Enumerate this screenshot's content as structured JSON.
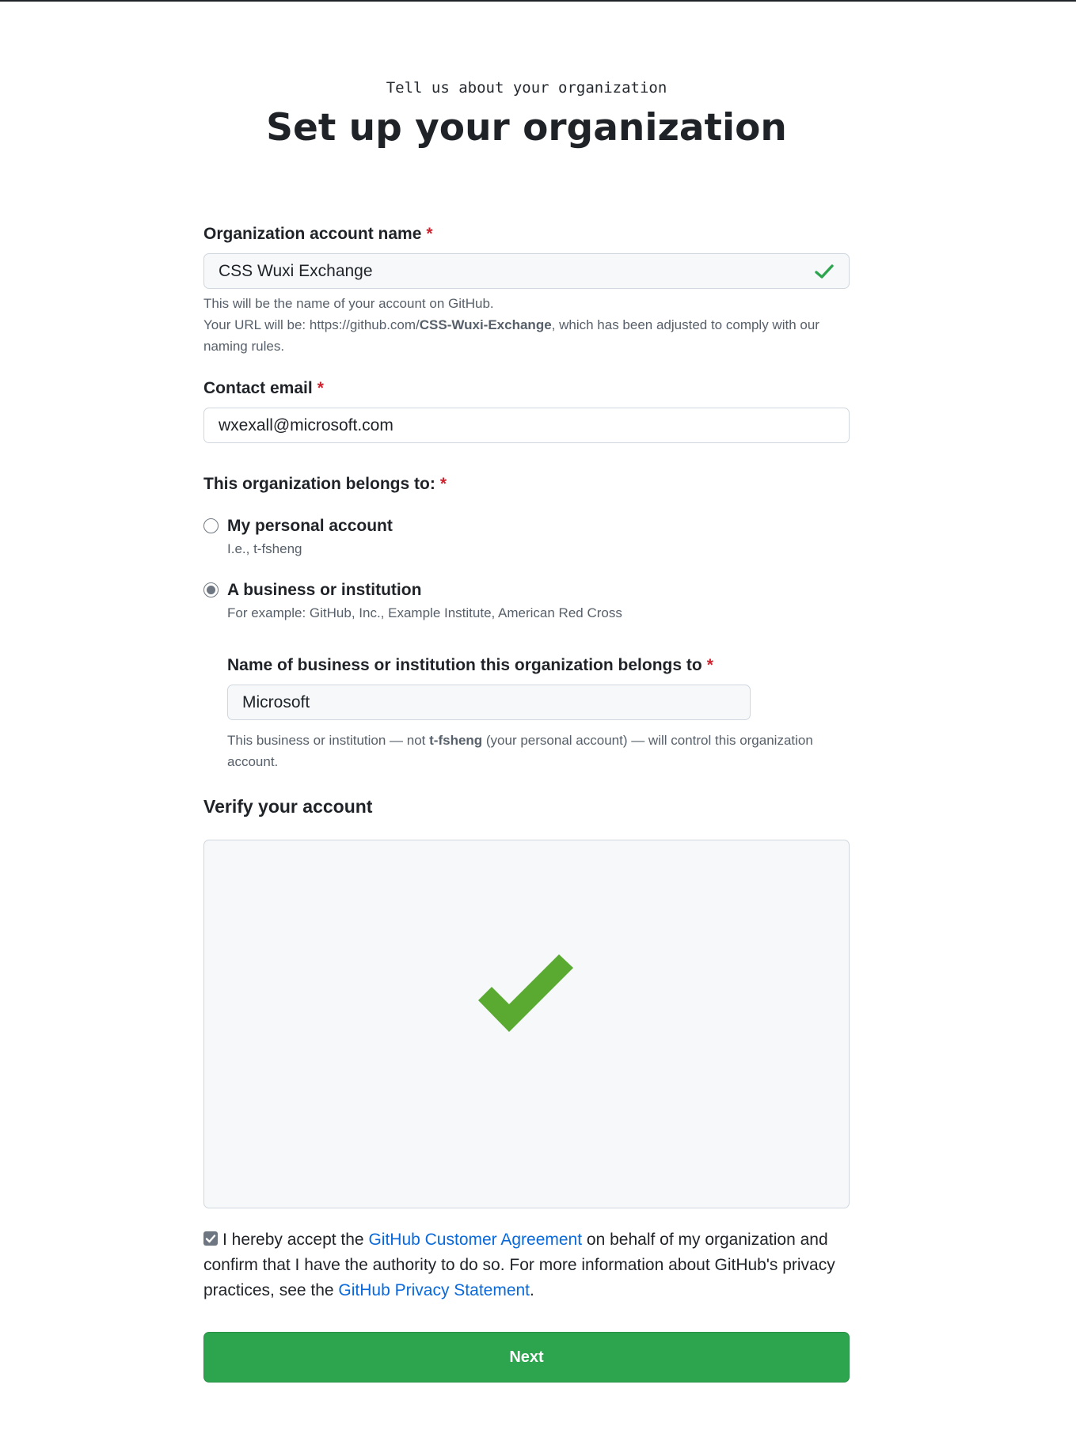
{
  "header": {
    "eyebrow": "Tell us about your organization",
    "title": "Set up your organization"
  },
  "org_name": {
    "label": "Organization account name",
    "required_mark": "*",
    "value": "CSS Wuxi Exchange",
    "status_icon": "check-icon",
    "note_line1": "This will be the name of your account on GitHub.",
    "note_prefix": "Your URL will be: https://github.com/",
    "note_slug": "CSS-Wuxi-Exchange",
    "note_suffix": ", which has been adjusted to comply with our naming rules."
  },
  "contact_email": {
    "label": "Contact email",
    "required_mark": "*",
    "value": "wxexall@microsoft.com"
  },
  "belongs_to": {
    "label": "This organization belongs to:",
    "required_mark": "*",
    "options": [
      {
        "label": "My personal account",
        "description": "I.e., t-fsheng",
        "selected": false
      },
      {
        "label": "A business or institution",
        "description": "For example: GitHub, Inc., Example Institute, American Red Cross",
        "selected": true
      }
    ]
  },
  "business_name": {
    "label": "Name of business or institution this organization belongs to",
    "required_mark": "*",
    "value": "Microsoft",
    "note_prefix": "This business or institution — not ",
    "note_user": "t-fsheng",
    "note_suffix": " (your personal account) — will control this organization account."
  },
  "verify": {
    "heading": "Verify your account",
    "status_icon": "big-check-icon",
    "check_color": "#5aaa32"
  },
  "agreement": {
    "checked": true,
    "text_1": "I hereby accept the ",
    "link_1": "GitHub Customer Agreement",
    "text_2": " on behalf of my organization and confirm that I have the authority to do so. For more information about GitHub's privacy practices, see the ",
    "link_2": "GitHub Privacy Statement",
    "text_3": "."
  },
  "actions": {
    "next_label": "Next"
  },
  "colors": {
    "primary_button": "#2da44e",
    "link": "#0969da",
    "required": "#cf222e",
    "success": "#5aaa32"
  }
}
